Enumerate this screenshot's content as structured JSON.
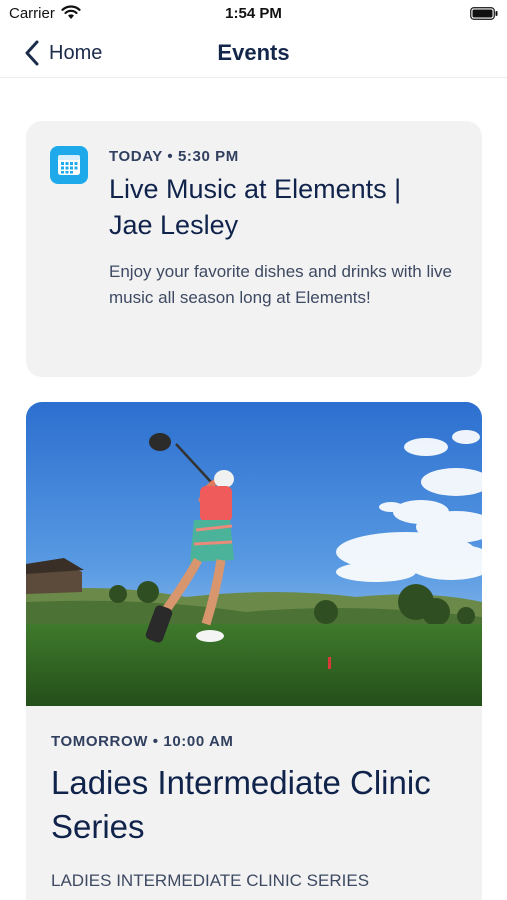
{
  "status_bar": {
    "carrier": "Carrier",
    "time": "1:54 PM",
    "icons": [
      "wifi-icon",
      "battery-icon"
    ]
  },
  "nav": {
    "back_label": "Home",
    "back_icon": "chevron-left-icon",
    "title": "Events"
  },
  "events": [
    {
      "icon": "calendar-icon",
      "icon_color": "#1ea9ea",
      "when": "TODAY • 5:30 PM",
      "title": "Live Music at Elements | Jae Lesley",
      "description": "Enjoy your favorite dishes and drinks with live music all season long at Elements!"
    },
    {
      "image": "golfer-swing-photo",
      "when": "TOMORROW • 10:00 AM",
      "title": "Ladies Intermediate Clinic Series",
      "description": "LADIES INTERMEDIATE CLINIC SERIES"
    }
  ],
  "colors": {
    "card_background": "#f2f2f3",
    "text_primary": "#10234a",
    "accent": "#1ea9ea"
  }
}
